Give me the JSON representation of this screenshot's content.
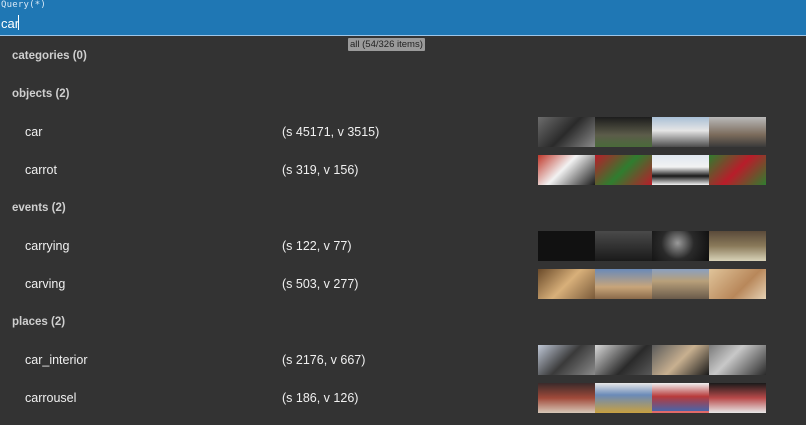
{
  "query": {
    "label": "Query(*)",
    "value": "car"
  },
  "all_badge": "all (54/326 items)",
  "sections": [
    {
      "title": "categories (0)",
      "rows": []
    },
    {
      "title": "objects (2)",
      "rows": [
        {
          "name": "car",
          "stats": "(s 45171, v 3515)"
        },
        {
          "name": "carrot",
          "stats": "(s 319, v 156)"
        }
      ]
    },
    {
      "title": "events (2)",
      "rows": [
        {
          "name": "carrying",
          "stats": "(s 122, v 77)"
        },
        {
          "name": "carving",
          "stats": "(s 503, v 277)"
        }
      ]
    },
    {
      "title": "places (2)",
      "rows": [
        {
          "name": "car_interior",
          "stats": "(s 2176, v 667)"
        },
        {
          "name": "carrousel",
          "stats": "(s 186, v 126)"
        }
      ]
    }
  ]
}
